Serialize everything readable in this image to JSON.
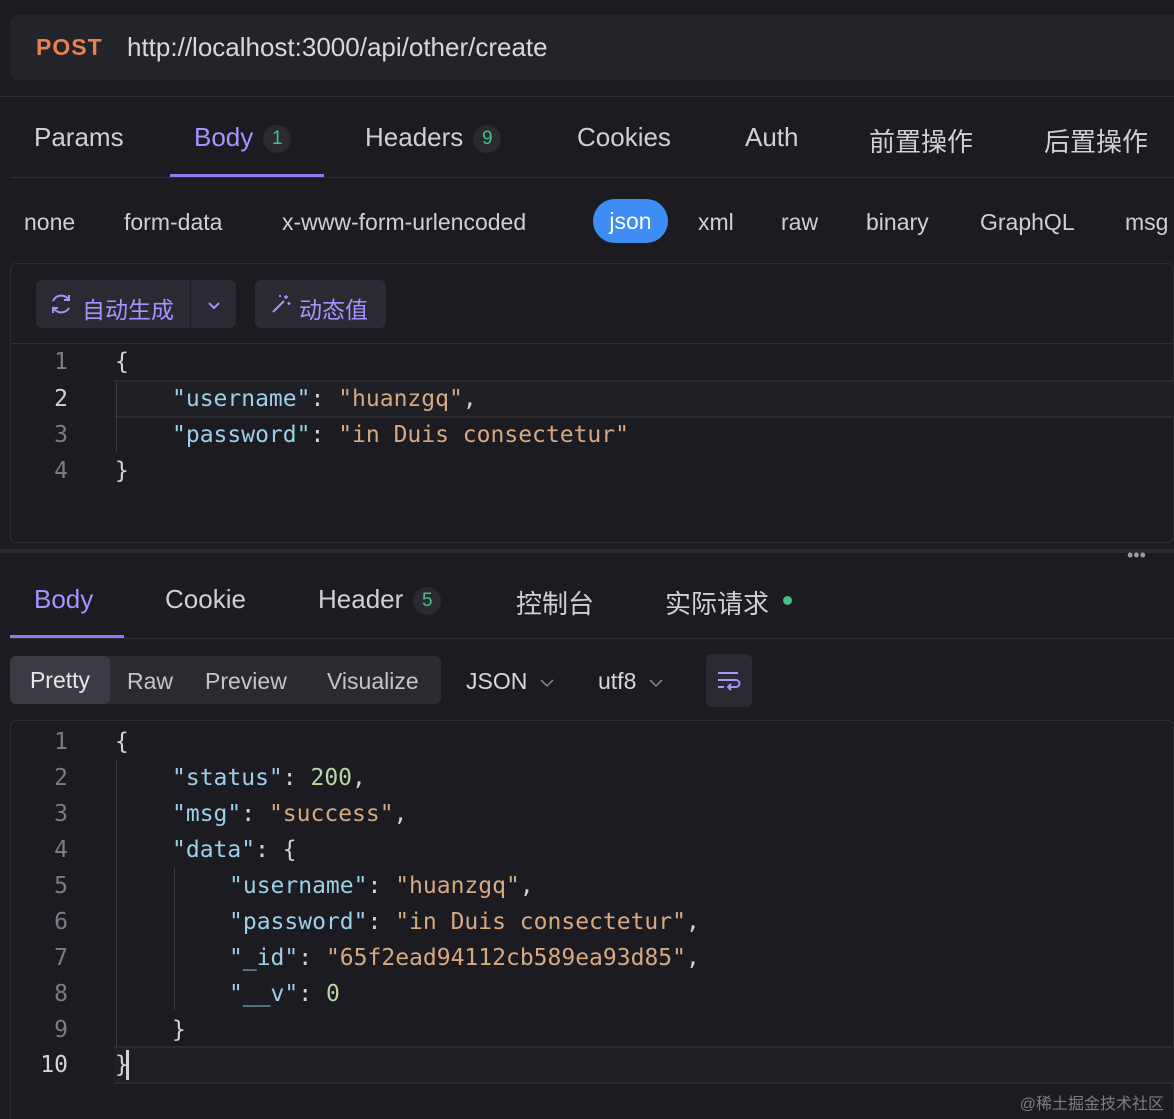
{
  "request": {
    "method": "POST",
    "url": "http://localhost:3000/api/other/create"
  },
  "request_tabs": [
    {
      "label": "Params"
    },
    {
      "label": "Body",
      "badge": "1"
    },
    {
      "label": "Headers",
      "badge": "9"
    },
    {
      "label": "Cookies"
    },
    {
      "label": "Auth"
    },
    {
      "label": "前置操作"
    },
    {
      "label": "后置操作"
    }
  ],
  "body_types": [
    "none",
    "form-data",
    "x-www-form-urlencoded",
    "json",
    "xml",
    "raw",
    "binary",
    "GraphQL",
    "msg"
  ],
  "body_toolbar": {
    "auto_generate": "自动生成",
    "dynamic_value": "动态值"
  },
  "request_editor": {
    "line_numbers": [
      "1",
      "2",
      "3",
      "4"
    ],
    "lines": [
      {
        "p1": "{"
      },
      {
        "key": "\"username\"",
        "sep": ": ",
        "val": "\"huanzgq\"",
        "end": ","
      },
      {
        "key": "\"password\"",
        "sep": ": ",
        "val": "\"in Duis consectetur\"",
        "end": ""
      },
      {
        "p1": "}"
      }
    ]
  },
  "response_tabs": [
    {
      "label": "Body"
    },
    {
      "label": "Cookie"
    },
    {
      "label": "Header",
      "badge": "5"
    },
    {
      "label": "控制台"
    },
    {
      "label": "实际请求"
    }
  ],
  "response_views": [
    "Pretty",
    "Raw",
    "Preview",
    "Visualize"
  ],
  "response_format": "JSON",
  "response_encoding": "utf8",
  "response_editor": {
    "line_numbers": [
      "1",
      "2",
      "3",
      "4",
      "5",
      "6",
      "7",
      "8",
      "9",
      "10"
    ],
    "lines": [
      {
        "p1": "{"
      },
      {
        "key": "\"status\"",
        "sep": ": ",
        "num": "200",
        "end": ","
      },
      {
        "key": "\"msg\"",
        "sep": ": ",
        "val": "\"success\"",
        "end": ","
      },
      {
        "key": "\"data\"",
        "sep": ": ",
        "end": "{"
      },
      {
        "key": "\"username\"",
        "sep": ": ",
        "val": "\"huanzgq\"",
        "end": ","
      },
      {
        "key": "\"password\"",
        "sep": ": ",
        "val": "\"in Duis consectetur\"",
        "end": ","
      },
      {
        "key": "\"_id\"",
        "sep": ": ",
        "val": "\"65f2ead94112cb589ea93d85\"",
        "end": ","
      },
      {
        "key": "\"__v\"",
        "sep": ": ",
        "num": "0",
        "end": ""
      },
      {
        "p1": "}"
      },
      {
        "p1": "}"
      }
    ]
  },
  "watermark": "@稀土掘金技术社区",
  "colors": {
    "method": "#e8804f",
    "active_tab": "#a594ff",
    "json_pill": "#3d8df2",
    "badge_text": "#46c08a",
    "status_dot": "#46c08a"
  }
}
